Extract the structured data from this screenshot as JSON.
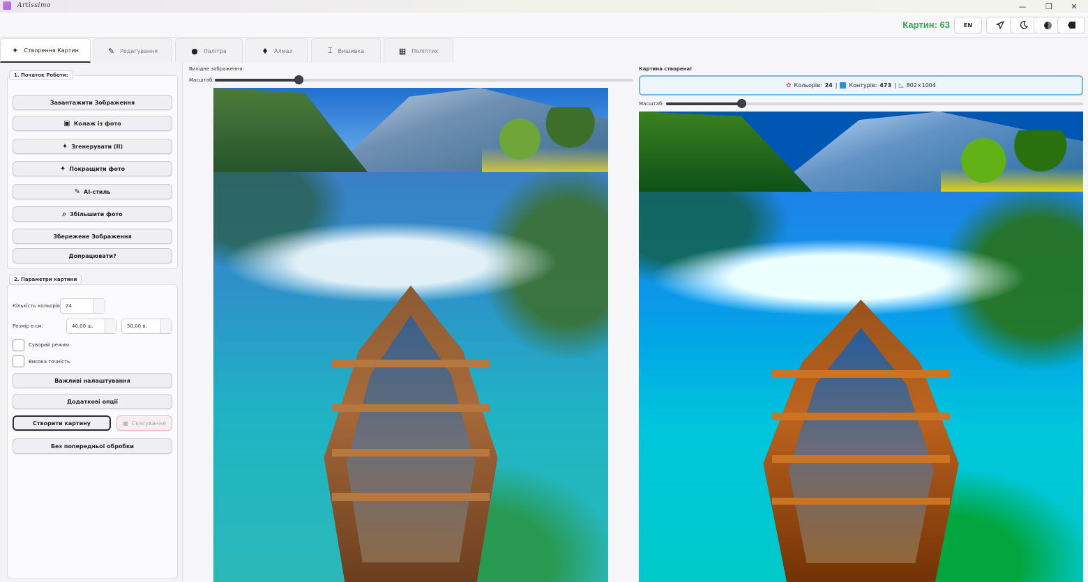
{
  "window": {
    "title": "Artissimo",
    "minimize": "—",
    "maximize": "❐",
    "close": "✕"
  },
  "topbar": {
    "count_label": "Картин: 63",
    "lang": "EN",
    "icons": [
      "send-icon",
      "moon-icon",
      "contrast-icon",
      "back-icon"
    ]
  },
  "tabs": [
    {
      "label": "Створення Картин",
      "icon": "sparkle-icon",
      "active": true
    },
    {
      "label": "Редагування",
      "icon": "pencil-icon",
      "active": false
    },
    {
      "label": "Палітра",
      "icon": "palette-icon",
      "active": false
    },
    {
      "label": "Алмаз",
      "icon": "diamond-icon",
      "active": false
    },
    {
      "label": "Вишивка",
      "icon": "spool-icon",
      "active": false
    },
    {
      "label": "Поліптих",
      "icon": "grid-icon",
      "active": false
    }
  ],
  "sidebar": {
    "section1_title": "1. Початок Роботи:",
    "buttons": {
      "upload": "Завантажити Зображення",
      "collage": "Колаж із фото",
      "generate": "Згенерувати (II)",
      "enhance": "Покращити фото",
      "ai_style": "AI-стиль",
      "upscale": "Збільшити фото",
      "saved": "Збережене Зображення",
      "refine": "Допрацювати?"
    },
    "section2_title": "2. Параметри картини",
    "colors_label": "Кількість кольорів:",
    "colors_value": "24",
    "size_label": "Розмір в см:",
    "width_value": "40,00 ш.",
    "height_value": "50,00 в.",
    "strict_mode": "Суворий режим",
    "high_precision": "Висока точність",
    "important_settings": "Важливі налаштування",
    "extra_options": "Додаткові опції",
    "create": "Створити картину",
    "cancel": "Скасування",
    "no_preprocess": "Без попередньої обробки"
  },
  "source": {
    "label": "Вихідне зображення:",
    "scale_label": "Масштаб:",
    "scale_level": 0.2
  },
  "result": {
    "label": "Картина створена!",
    "colors_label": "Кольорів:",
    "colors_value": "24",
    "sep1": "|",
    "contours_label": "Контурів:",
    "contours_value": "473",
    "sep2": "|",
    "dims": "802×1004",
    "scale_label": "Масштаб:",
    "scale_level": 0.18
  },
  "colors": {
    "accent_green": "#2fa84f",
    "info_border": "#7ab5dc",
    "cancel_border": "#f2b8c0"
  }
}
